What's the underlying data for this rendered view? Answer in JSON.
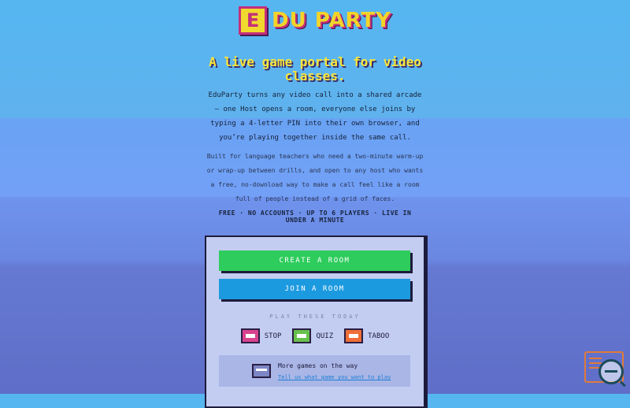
{
  "header": {
    "logo_letter": "E",
    "logo_text": "DU PARTY"
  },
  "hero": {
    "headline": "A live game portal for video classes.",
    "intro": "EduParty turns any video call into a shared arcade – one Host opens a room, everyone else joins by typing a 4-letter PIN into their own browser, and you’re playing together inside the same call.",
    "secondary": "Built for language teachers who need a two-minute warm-up or wrap-up between drills, and open to any host who wants a free, no-download way to make a call feel like a room full of people instead of a grid of faces.",
    "tagline": "FREE · NO ACCOUNTS · UP TO 6 PLAYERS · LIVE IN UNDER A MINUTE"
  },
  "actions": {
    "create_label": "CREATE A ROOM",
    "join_label": "JOIN A ROOM"
  },
  "games": {
    "section_label": "PLAY THESE TODAY",
    "items": [
      {
        "name": "STOP",
        "icon": "stop-game-icon",
        "color": "#d8428f"
      },
      {
        "name": "QUIZ",
        "icon": "quiz-game-icon",
        "color": "#68c04c"
      },
      {
        "name": "TABOO",
        "icon": "taboo-game-icon",
        "color": "#ef6e38"
      }
    ]
  },
  "more": {
    "title": "More games on the way",
    "link": "Tell us what game you want to play"
  },
  "colors": {
    "accent_yellow": "#f8e53a",
    "create_green": "#2ecc5c",
    "join_blue": "#1c9ae0",
    "brand_pink": "#c42f7c"
  }
}
